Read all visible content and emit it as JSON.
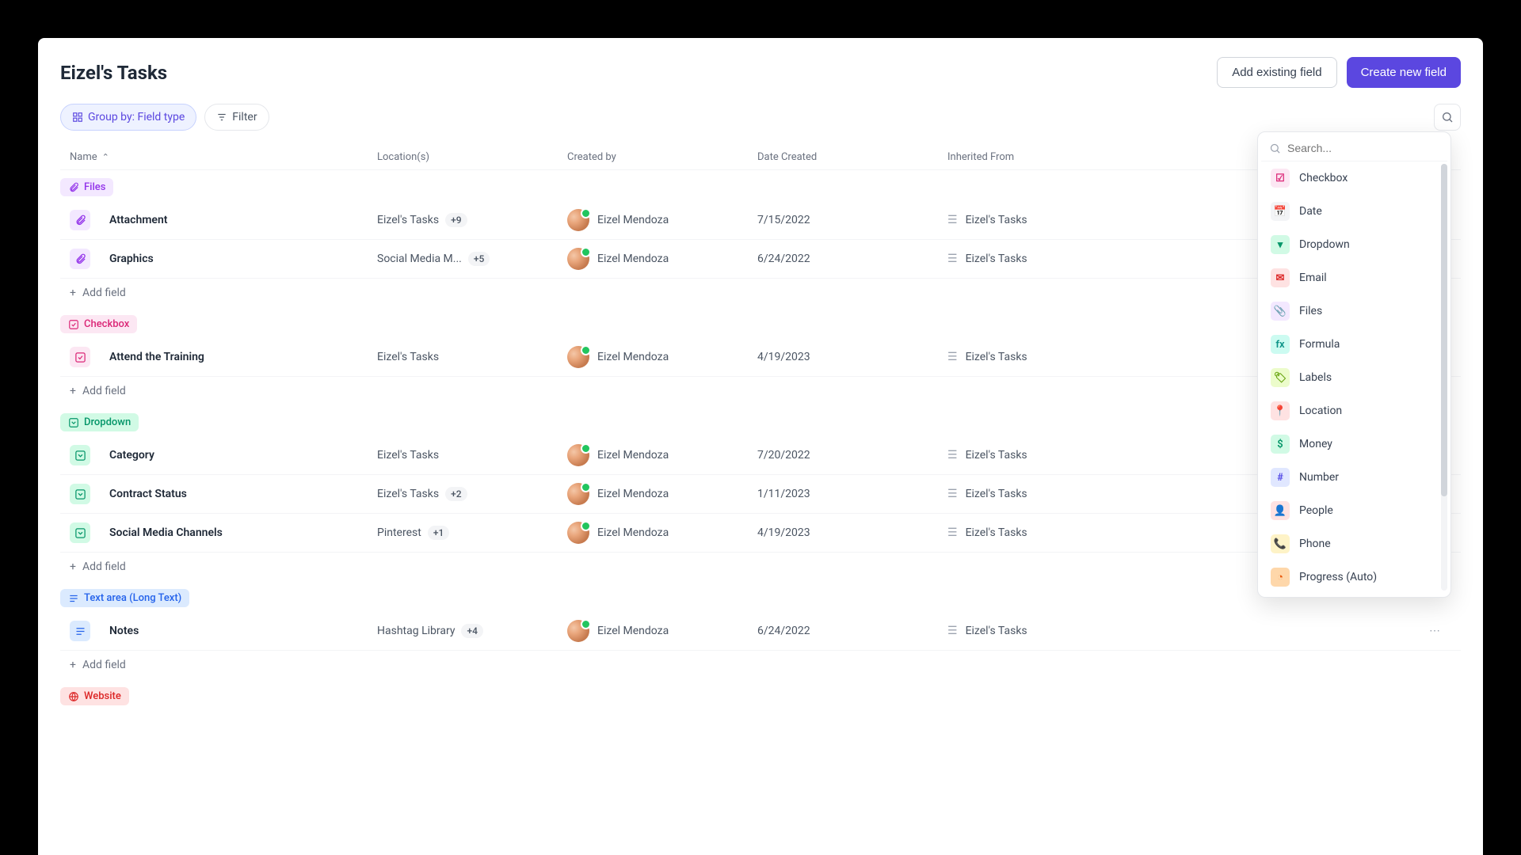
{
  "page": {
    "title": "Eizel's Tasks",
    "add_existing": "Add existing field",
    "create_new": "Create new field",
    "group_by_label": "Group by: Field type",
    "filter_label": "Filter",
    "search_placeholder": "Search...",
    "add_field_label": "Add field"
  },
  "columns": {
    "name": "Name",
    "locations": "Location(s)",
    "created_by": "Created by",
    "date_created": "Date Created",
    "inherited_from": "Inherited From"
  },
  "groups": [
    {
      "id": "files",
      "label": "Files",
      "rows": [
        {
          "name": "Attachment",
          "location": "Eizel's Tasks",
          "loc_more": "+9",
          "by": "Eizel Mendoza",
          "date": "7/15/2022",
          "inherited": "Eizel's Tasks"
        },
        {
          "name": "Graphics",
          "location": "Social Media M...",
          "loc_more": "+5",
          "by": "Eizel Mendoza",
          "date": "6/24/2022",
          "inherited": "Eizel's Tasks"
        }
      ]
    },
    {
      "id": "checkbox",
      "label": "Checkbox",
      "rows": [
        {
          "name": "Attend the Training",
          "location": "Eizel's Tasks",
          "loc_more": "",
          "by": "Eizel Mendoza",
          "date": "4/19/2023",
          "inherited": "Eizel's Tasks"
        }
      ]
    },
    {
      "id": "dropdown",
      "label": "Dropdown",
      "rows": [
        {
          "name": "Category",
          "location": "Eizel's Tasks",
          "loc_more": "",
          "by": "Eizel Mendoza",
          "date": "7/20/2022",
          "inherited": "Eizel's Tasks"
        },
        {
          "name": "Contract Status",
          "location": "Eizel's Tasks",
          "loc_more": "+2",
          "by": "Eizel Mendoza",
          "date": "1/11/2023",
          "inherited": "Eizel's Tasks"
        },
        {
          "name": "Social Media Channels",
          "location": "Pinterest",
          "loc_more": "+1",
          "by": "Eizel Mendoza",
          "date": "4/19/2023",
          "inherited": "Eizel's Tasks"
        }
      ]
    },
    {
      "id": "text",
      "label": "Text area (Long Text)",
      "rows": [
        {
          "name": "Notes",
          "location": "Hashtag Library",
          "loc_more": "+4",
          "by": "Eizel Mendoza",
          "date": "6/24/2022",
          "inherited": "Eizel's Tasks"
        }
      ]
    },
    {
      "id": "website",
      "label": "Website",
      "rows": []
    }
  ],
  "field_types": [
    {
      "id": "checkbox",
      "label": "Checkbox",
      "glyph": "☑"
    },
    {
      "id": "date",
      "label": "Date",
      "glyph": "📅"
    },
    {
      "id": "dropdown",
      "label": "Dropdown",
      "glyph": "▾"
    },
    {
      "id": "email",
      "label": "Email",
      "glyph": "✉"
    },
    {
      "id": "files",
      "label": "Files",
      "glyph": "📎"
    },
    {
      "id": "formula",
      "label": "Formula",
      "glyph": "fx"
    },
    {
      "id": "labels",
      "label": "Labels",
      "glyph": "🏷"
    },
    {
      "id": "location",
      "label": "Location",
      "glyph": "📍"
    },
    {
      "id": "money",
      "label": "Money",
      "glyph": "$"
    },
    {
      "id": "number",
      "label": "Number",
      "glyph": "#"
    },
    {
      "id": "people",
      "label": "People",
      "glyph": "👤"
    },
    {
      "id": "phone",
      "label": "Phone",
      "glyph": "📞"
    },
    {
      "id": "progress",
      "label": "Progress (Auto)",
      "glyph": "◔"
    }
  ]
}
